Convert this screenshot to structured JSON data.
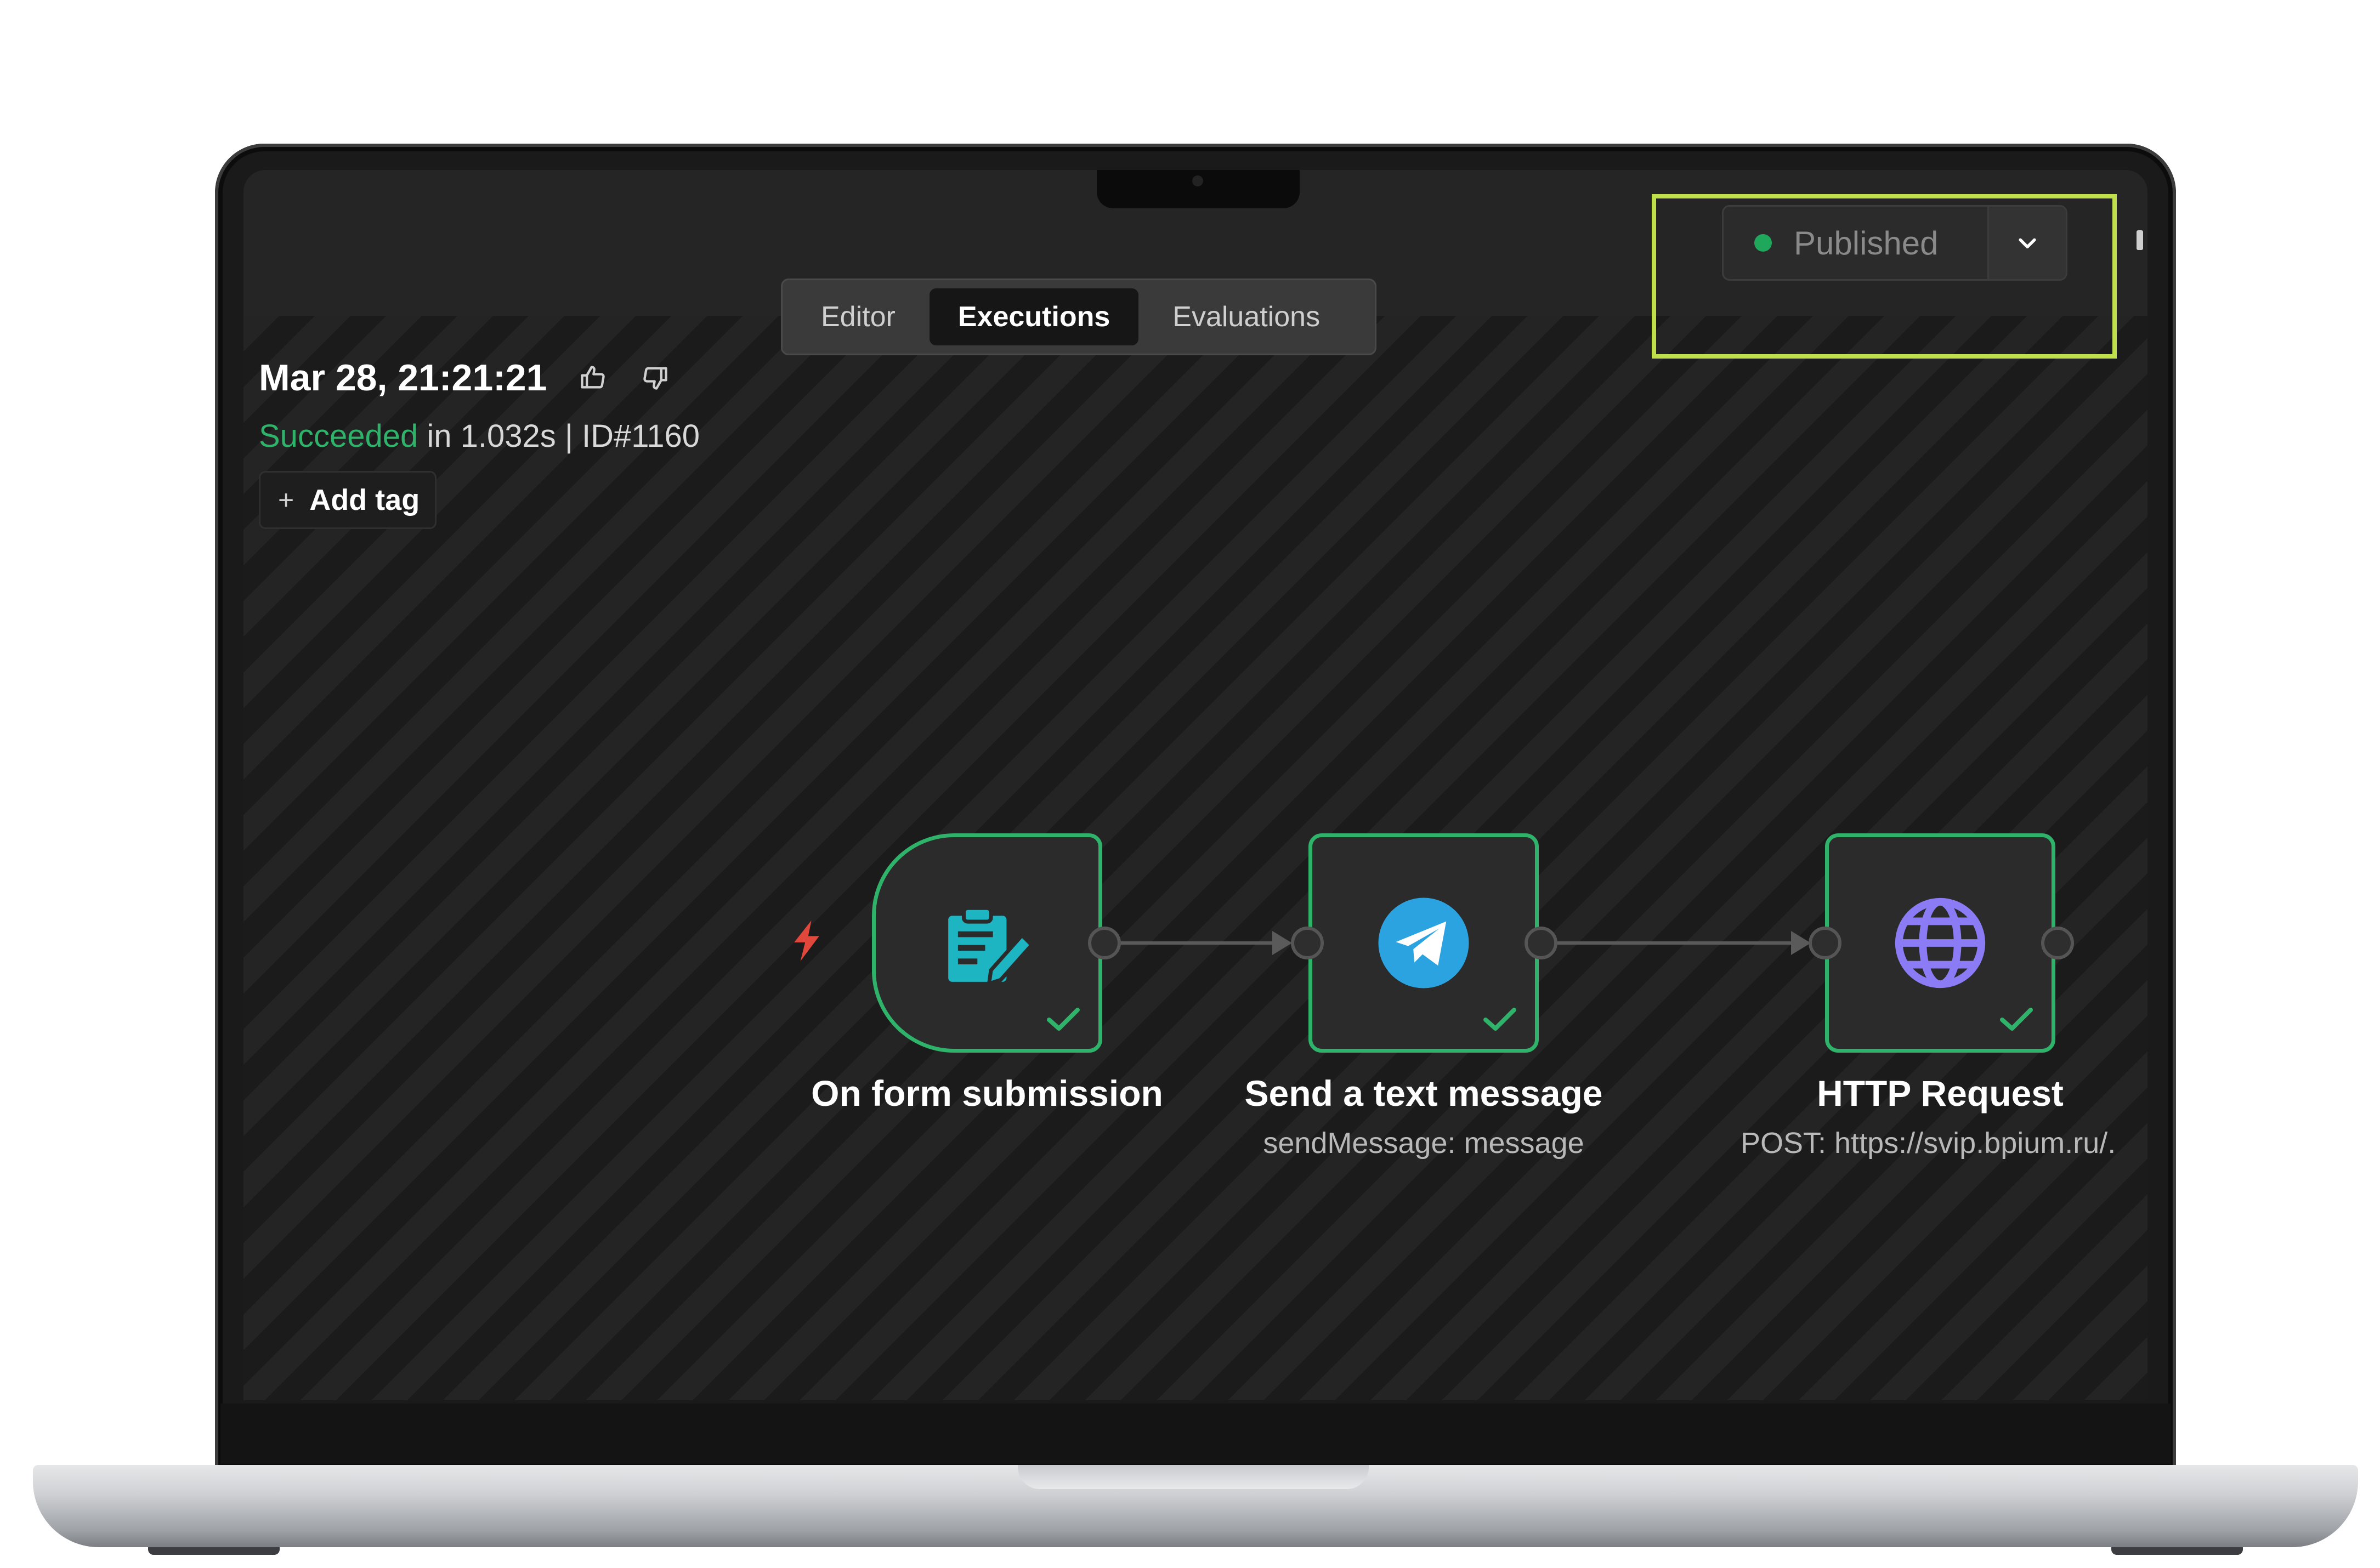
{
  "tabs": [
    {
      "label": "Editor"
    },
    {
      "label": "Executions"
    },
    {
      "label": "Evaluations"
    }
  ],
  "publish": {
    "status": "Published"
  },
  "execution": {
    "date": "Mar 28, 21:21:21",
    "status": "Succeeded",
    "duration_text": "in 1.032s | ID#1160",
    "add_tag": "Add tag"
  },
  "nodes": [
    {
      "title": "On form submission",
      "subtitle": "",
      "icon": "form-icon"
    },
    {
      "title": "Send a text message",
      "subtitle": "sendMessage: message",
      "icon": "telegram-icon"
    },
    {
      "title": "HTTP Request",
      "subtitle": "POST: https://svip.bpium.ru/.",
      "icon": "globe-icon"
    }
  ],
  "colors": {
    "success": "#2fb36a",
    "highlight": "#bfe04a",
    "telegram": "#2aa3e0",
    "form": "#1eb5c2",
    "globe": "#8b7cf6",
    "trigger": "#e2473b"
  }
}
